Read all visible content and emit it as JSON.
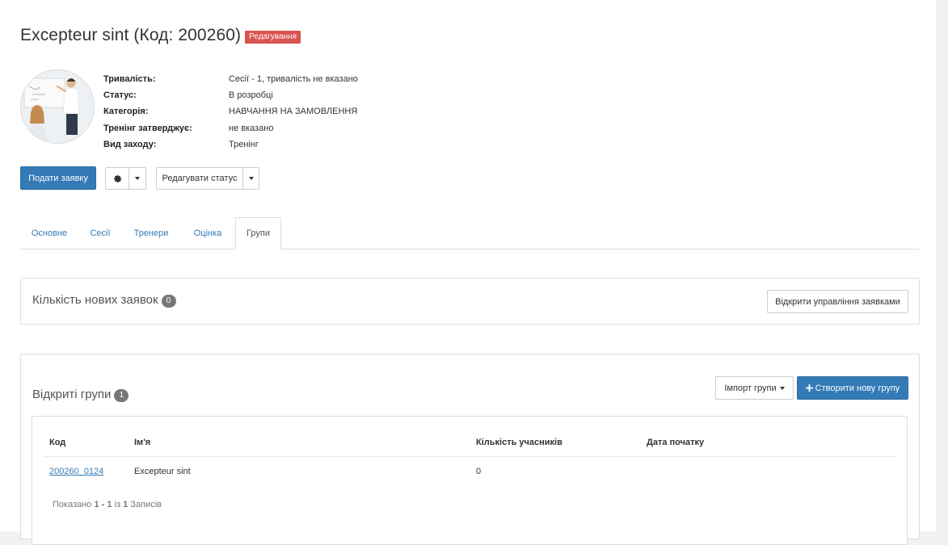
{
  "header": {
    "title": "Excepteur sint (Код: 200260)",
    "status_badge": "Редагування"
  },
  "info": [
    {
      "label": "Тривалість:",
      "value": "Сесії - 1, тривалість не вказано"
    },
    {
      "label": "Статус:",
      "value": "В розробці"
    },
    {
      "label": "Категорія:",
      "value": "НАВЧАННЯ НА ЗАМОВЛЕННЯ"
    },
    {
      "label": "Тренінг затверджує:",
      "value": "не вказано"
    },
    {
      "label": "Вид заходу:",
      "value": "Тренінг"
    }
  ],
  "actions": {
    "apply_label": "Подати заявку",
    "edit_status_label": "Редагувати статус"
  },
  "tabs": [
    {
      "label": "Основне"
    },
    {
      "label": "Сесії"
    },
    {
      "label": "Тренери"
    },
    {
      "label": "Оцінка"
    },
    {
      "label": "Групи",
      "active": true
    }
  ],
  "requests_panel": {
    "title": "Кількість нових заявок",
    "count": "0",
    "manage_button": "Відкрити управління заявками"
  },
  "groups_panel": {
    "title": "Відкриті групи",
    "count": "1",
    "import_button": "Імпорт групи",
    "create_button": "Створити нову групу",
    "columns": [
      "Код",
      "Ім'я",
      "Кількість учасників",
      "Дата початку"
    ],
    "rows": [
      {
        "code": "200260_0124",
        "name": "Excepteur sint",
        "participants": "0",
        "start_date": ""
      }
    ],
    "summary_prefix": "Показано",
    "summary_range": "1 - 1",
    "summary_of": "із",
    "summary_total": "1",
    "summary_suffix": "Записів"
  },
  "colors": {
    "primary": "#337ab7",
    "danger": "#d9534f",
    "badge_gray": "#777777"
  },
  "icons": [
    "gear-icon",
    "caret-down-icon",
    "plus-icon"
  ]
}
